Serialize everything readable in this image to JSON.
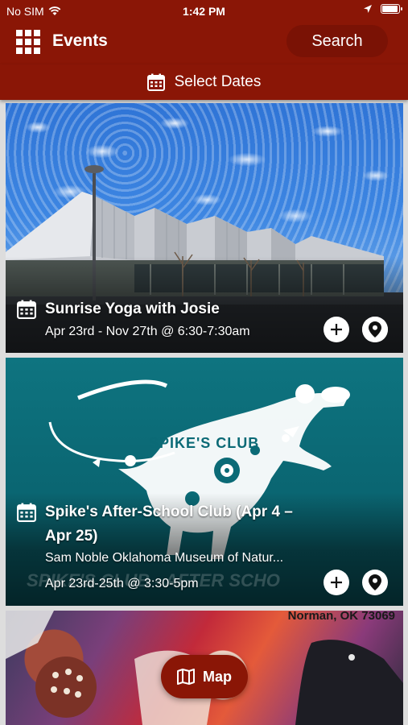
{
  "status": {
    "carrier": "No SIM",
    "time": "1:42 PM"
  },
  "header": {
    "title": "Events",
    "search_label": "Search"
  },
  "date_filter": {
    "label": "Select Dates"
  },
  "events": [
    {
      "title": "Sunrise Yoga with Josie",
      "when": "Apr 23rd - Nov 27th @ 6:30-7:30am"
    },
    {
      "title_line1": "Spike's After-School Club (Apr 4 –",
      "title_line2": "Apr 25)",
      "venue": "Sam Noble Oklahoma Museum of Natur...",
      "when": "Apr 23rd-25th @ 3:30-5pm",
      "image_text": "SPIKE'S CLUB",
      "image_overlay_text": "SPIKE'S CLUB - AFTER SCHO"
    },
    {
      "image_text": "Norman, OK 73069"
    }
  ],
  "map_button": {
    "label": "Map"
  },
  "colors": {
    "brand": "#8a1606",
    "teal": "#0e7480"
  },
  "icons": [
    "grid-menu-icon",
    "calendar-icon",
    "plus-icon",
    "map-pin-icon",
    "map-icon",
    "wifi-icon",
    "location-arrow-icon",
    "battery-icon"
  ]
}
